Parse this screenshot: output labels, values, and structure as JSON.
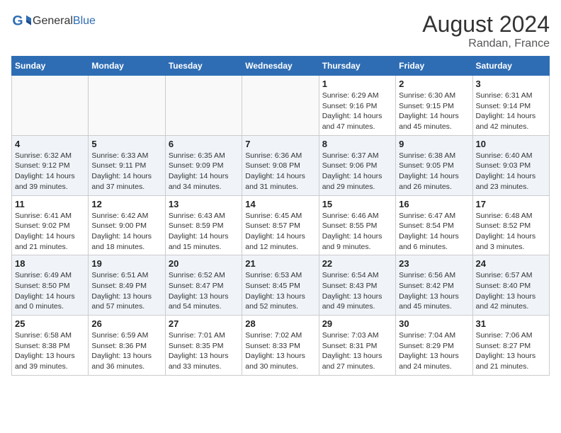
{
  "header": {
    "logo_general": "General",
    "logo_blue": "Blue",
    "month_year": "August 2024",
    "location": "Randan, France"
  },
  "days_of_week": [
    "Sunday",
    "Monday",
    "Tuesday",
    "Wednesday",
    "Thursday",
    "Friday",
    "Saturday"
  ],
  "weeks": [
    [
      {
        "day": "",
        "info": ""
      },
      {
        "day": "",
        "info": ""
      },
      {
        "day": "",
        "info": ""
      },
      {
        "day": "",
        "info": ""
      },
      {
        "day": "1",
        "info": "Sunrise: 6:29 AM\nSunset: 9:16 PM\nDaylight: 14 hours and 47 minutes."
      },
      {
        "day": "2",
        "info": "Sunrise: 6:30 AM\nSunset: 9:15 PM\nDaylight: 14 hours and 45 minutes."
      },
      {
        "day": "3",
        "info": "Sunrise: 6:31 AM\nSunset: 9:14 PM\nDaylight: 14 hours and 42 minutes."
      }
    ],
    [
      {
        "day": "4",
        "info": "Sunrise: 6:32 AM\nSunset: 9:12 PM\nDaylight: 14 hours and 39 minutes."
      },
      {
        "day": "5",
        "info": "Sunrise: 6:33 AM\nSunset: 9:11 PM\nDaylight: 14 hours and 37 minutes."
      },
      {
        "day": "6",
        "info": "Sunrise: 6:35 AM\nSunset: 9:09 PM\nDaylight: 14 hours and 34 minutes."
      },
      {
        "day": "7",
        "info": "Sunrise: 6:36 AM\nSunset: 9:08 PM\nDaylight: 14 hours and 31 minutes."
      },
      {
        "day": "8",
        "info": "Sunrise: 6:37 AM\nSunset: 9:06 PM\nDaylight: 14 hours and 29 minutes."
      },
      {
        "day": "9",
        "info": "Sunrise: 6:38 AM\nSunset: 9:05 PM\nDaylight: 14 hours and 26 minutes."
      },
      {
        "day": "10",
        "info": "Sunrise: 6:40 AM\nSunset: 9:03 PM\nDaylight: 14 hours and 23 minutes."
      }
    ],
    [
      {
        "day": "11",
        "info": "Sunrise: 6:41 AM\nSunset: 9:02 PM\nDaylight: 14 hours and 21 minutes."
      },
      {
        "day": "12",
        "info": "Sunrise: 6:42 AM\nSunset: 9:00 PM\nDaylight: 14 hours and 18 minutes."
      },
      {
        "day": "13",
        "info": "Sunrise: 6:43 AM\nSunset: 8:59 PM\nDaylight: 14 hours and 15 minutes."
      },
      {
        "day": "14",
        "info": "Sunrise: 6:45 AM\nSunset: 8:57 PM\nDaylight: 14 hours and 12 minutes."
      },
      {
        "day": "15",
        "info": "Sunrise: 6:46 AM\nSunset: 8:55 PM\nDaylight: 14 hours and 9 minutes."
      },
      {
        "day": "16",
        "info": "Sunrise: 6:47 AM\nSunset: 8:54 PM\nDaylight: 14 hours and 6 minutes."
      },
      {
        "day": "17",
        "info": "Sunrise: 6:48 AM\nSunset: 8:52 PM\nDaylight: 14 hours and 3 minutes."
      }
    ],
    [
      {
        "day": "18",
        "info": "Sunrise: 6:49 AM\nSunset: 8:50 PM\nDaylight: 14 hours and 0 minutes."
      },
      {
        "day": "19",
        "info": "Sunrise: 6:51 AM\nSunset: 8:49 PM\nDaylight: 13 hours and 57 minutes."
      },
      {
        "day": "20",
        "info": "Sunrise: 6:52 AM\nSunset: 8:47 PM\nDaylight: 13 hours and 54 minutes."
      },
      {
        "day": "21",
        "info": "Sunrise: 6:53 AM\nSunset: 8:45 PM\nDaylight: 13 hours and 52 minutes."
      },
      {
        "day": "22",
        "info": "Sunrise: 6:54 AM\nSunset: 8:43 PM\nDaylight: 13 hours and 49 minutes."
      },
      {
        "day": "23",
        "info": "Sunrise: 6:56 AM\nSunset: 8:42 PM\nDaylight: 13 hours and 45 minutes."
      },
      {
        "day": "24",
        "info": "Sunrise: 6:57 AM\nSunset: 8:40 PM\nDaylight: 13 hours and 42 minutes."
      }
    ],
    [
      {
        "day": "25",
        "info": "Sunrise: 6:58 AM\nSunset: 8:38 PM\nDaylight: 13 hours and 39 minutes."
      },
      {
        "day": "26",
        "info": "Sunrise: 6:59 AM\nSunset: 8:36 PM\nDaylight: 13 hours and 36 minutes."
      },
      {
        "day": "27",
        "info": "Sunrise: 7:01 AM\nSunset: 8:35 PM\nDaylight: 13 hours and 33 minutes."
      },
      {
        "day": "28",
        "info": "Sunrise: 7:02 AM\nSunset: 8:33 PM\nDaylight: 13 hours and 30 minutes."
      },
      {
        "day": "29",
        "info": "Sunrise: 7:03 AM\nSunset: 8:31 PM\nDaylight: 13 hours and 27 minutes."
      },
      {
        "day": "30",
        "info": "Sunrise: 7:04 AM\nSunset: 8:29 PM\nDaylight: 13 hours and 24 minutes."
      },
      {
        "day": "31",
        "info": "Sunrise: 7:06 AM\nSunset: 8:27 PM\nDaylight: 13 hours and 21 minutes."
      }
    ]
  ]
}
